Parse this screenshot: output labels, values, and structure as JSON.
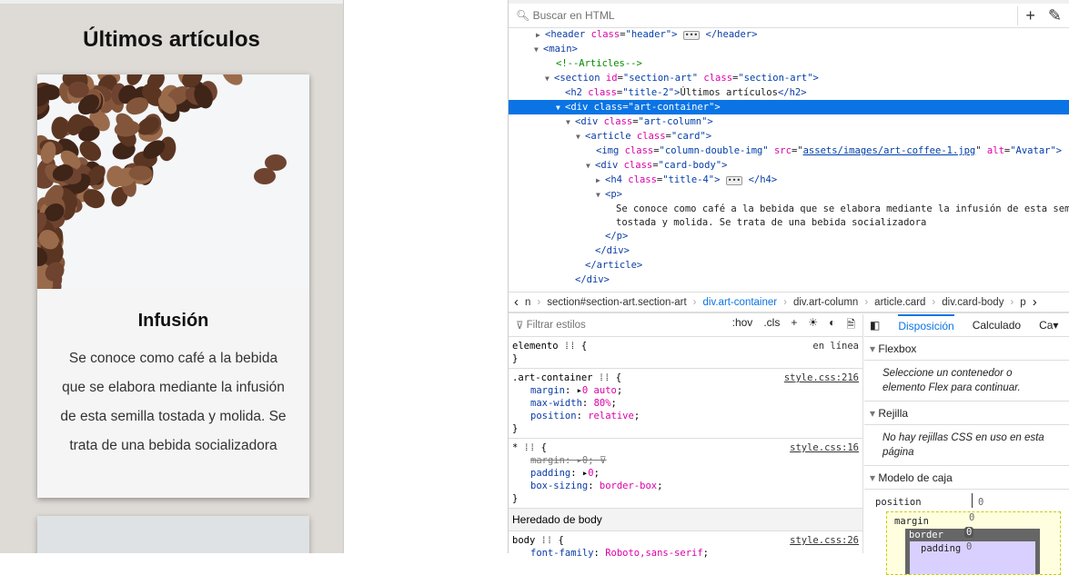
{
  "page": {
    "title": "Últimos artículos",
    "card": {
      "title": "Infusión",
      "text": "Se conoce como café a la bebida que se elabora mediante la infusión de esta semilla tostada y molida. Se trata de una bebida socializadora"
    }
  },
  "devtools": {
    "search_placeholder": "Buscar en HTML",
    "tree": [
      {
        "level": 0,
        "twisty": "▶",
        "html": "header"
      },
      {
        "level": 0,
        "twisty": "▼",
        "html": "main"
      },
      {
        "level": 1,
        "html": "comment"
      },
      {
        "level": 1,
        "twisty": "▼",
        "html": "section"
      },
      {
        "level": 2,
        "html": "h2"
      },
      {
        "level": 2,
        "twisty": "▼",
        "html": "div-art-container",
        "selected": true
      },
      {
        "level": 3,
        "twisty": "▼",
        "html": "div-art-column"
      },
      {
        "level": 4,
        "twisty": "▼",
        "html": "article"
      },
      {
        "level": 5,
        "html": "img"
      },
      {
        "level": 5,
        "twisty": "▼",
        "html": "div-card-body"
      },
      {
        "level": 6,
        "twisty": "▶",
        "html": "h4"
      },
      {
        "level": 6,
        "twisty": "▼",
        "html": "p"
      },
      {
        "level": 7,
        "html": "text1"
      },
      {
        "level": 7,
        "html": "text2"
      },
      {
        "level": 6,
        "html": "/p"
      },
      {
        "level": 5,
        "html": "/div"
      },
      {
        "level": 4,
        "html": "/article"
      },
      {
        "level": 3,
        "html": "/div"
      }
    ],
    "strings": {
      "header_open": "<header ",
      "header_class": "class",
      "header_val": "\"header\"",
      "header_close": "</header>",
      "main": "<main>",
      "comment": "<!--Articles-->",
      "section_open": "<section ",
      "id_attr": "id",
      "section_id": "\"section-art\"",
      "class_attr": "class",
      "section_class": "\"section-art\"",
      "h2": "\"title-2\"",
      "h2_text": "Últimos artículos",
      "h2_close": "</h2>",
      "container": "\"art-container\"",
      "column": "\"art-column\"",
      "card": "\"card\"",
      "img_class": "\"column-double-img\"",
      "img_src": "assets/images/art-coffee-1.jpg",
      "img_alt": "\"Avatar\"",
      "card_body": "\"card-body\"",
      "h4": "\"title-4\"",
      "p_line1": "Se conoce como café a la bebida que se elabora mediante la infusión de esta semilla",
      "p_line2": "tostada y molida. Se trata de una bebida socializadora"
    },
    "breadcrumb": [
      "n",
      "section#section-art.section-art",
      "div.art-container",
      "div.art-column",
      "article.card",
      "div.card-body",
      "p"
    ],
    "styles": {
      "filter_placeholder": "Filtrar estilos",
      "hov": ":hov",
      "cls": ".cls",
      "element": "elemento",
      "inline": "en línea",
      "rule1_selector": ".art-container",
      "rule1_src": "style.css:216",
      "rule1_props": [
        [
          "margin",
          "0 auto"
        ],
        [
          "max-width",
          "80%"
        ],
        [
          "position",
          "relative"
        ]
      ],
      "rule2_selector": "*",
      "rule2_src": "style.css:16",
      "rule2_props": [
        [
          "margin",
          "0"
        ],
        [
          "padding",
          "0"
        ],
        [
          "box-sizing",
          "border-box"
        ]
      ],
      "inherited": "Heredado de body",
      "rule3_selector": "body",
      "rule3_src": "style.css:26",
      "rule3_props": [
        [
          "font-family",
          "Roboto,sans-serif"
        ]
      ]
    },
    "layout": {
      "tabs": [
        "Disposición",
        "Calculado",
        "Ca"
      ],
      "flexbox": "Flexbox",
      "flexbox_note": "Seleccione un contenedor o elemento Flex para continuar.",
      "grid": "Rejilla",
      "grid_note": "No hay rejillas CSS en uso en esta página",
      "boxmodel": "Modelo de caja",
      "position": "position",
      "position_val": "0",
      "margin": "margin",
      "margin_val": "0",
      "border": "border",
      "border_val": "0",
      "padding": "padding",
      "padding_val": "0"
    }
  }
}
